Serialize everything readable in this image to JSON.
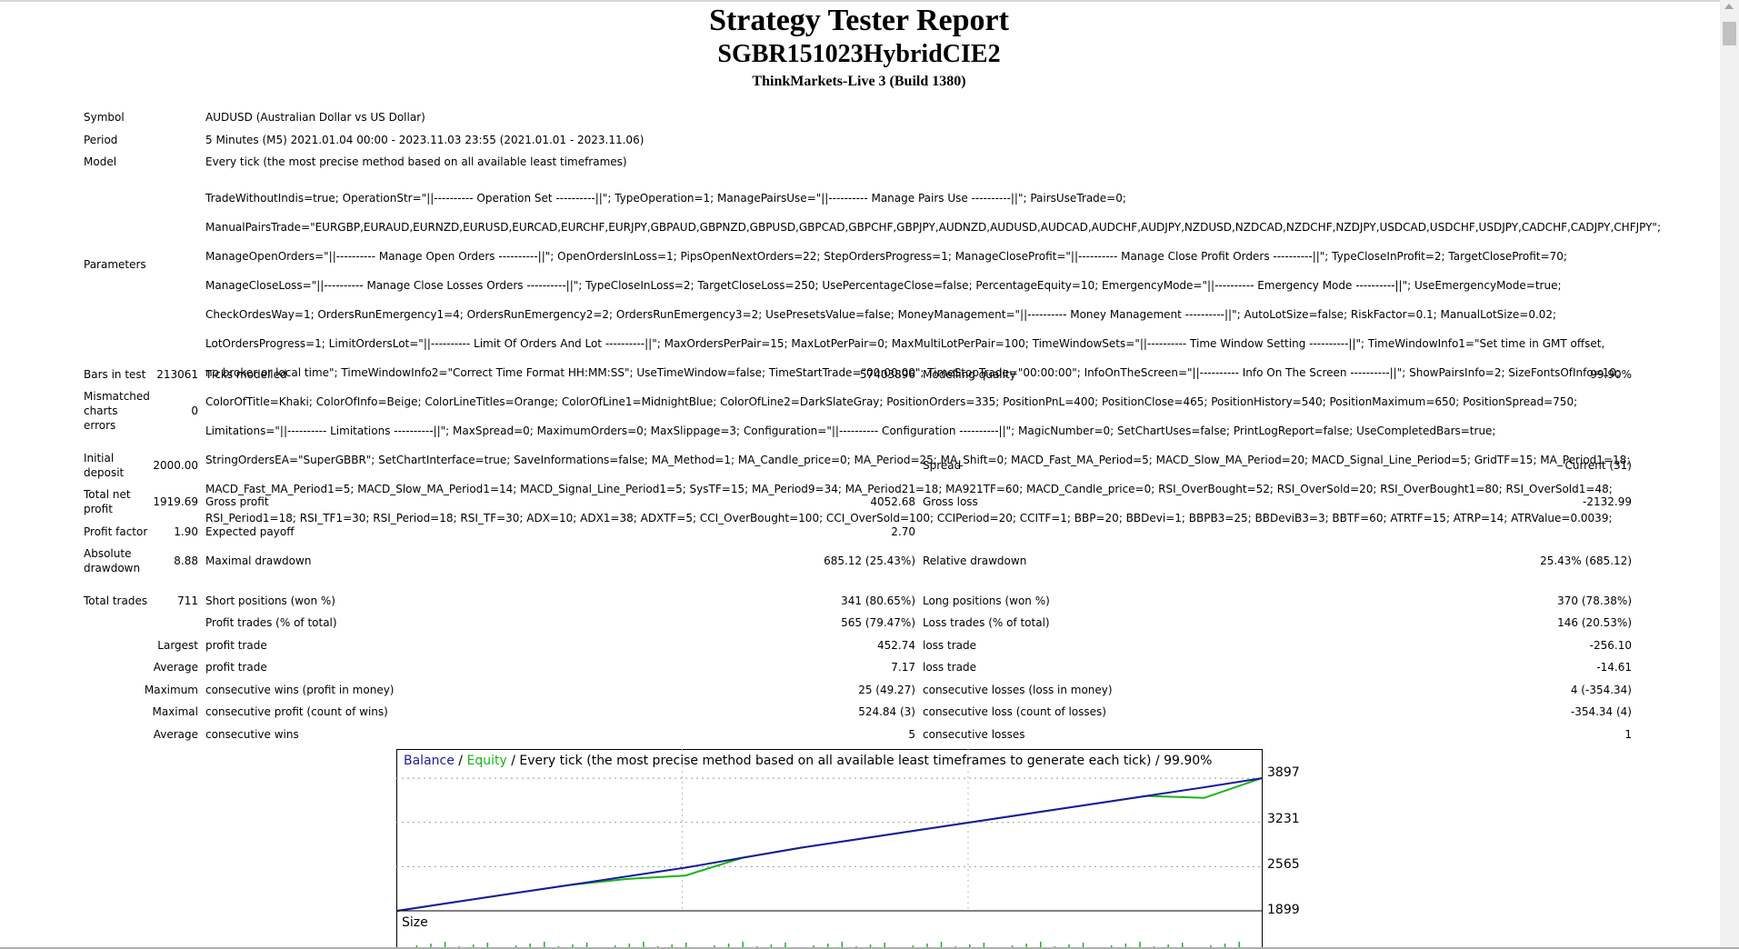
{
  "header": {
    "title": "Strategy Tester Report",
    "ea_name": "SGBR151023HybridCIE2",
    "server": "ThinkMarkets-Live 3 (Build 1380)"
  },
  "info": {
    "symbol_label": "Symbol",
    "symbol_value": "AUDUSD (Australian Dollar vs US Dollar)",
    "period_label": "Period",
    "period_value": "5 Minutes (M5) 2021.01.04 00:00 - 2023.11.03 23:55 (2021.01.01 - 2023.11.06)",
    "model_label": "Model",
    "model_value": "Every tick (the most precise method based on all available least timeframes)",
    "parameters_label": "Parameters",
    "parameters_lines": [
      "TradeWithoutIndis=true; OperationStr=\"||---------- Operation Set ----------||\"; TypeOperation=1; ManagePairsUse=\"||---------- Manage Pairs Use ----------||\"; PairsUseTrade=0;",
      "ManualPairsTrade=\"EURGBP,EURAUD,EURNZD,EURUSD,EURCAD,EURCHF,EURJPY,GBPAUD,GBPNZD,GBPUSD,GBPCAD,GBPCHF,GBPJPY,AUDNZD,AUDUSD,AUDCAD,AUDCHF,AUDJPY,NZDUSD,NZDCAD,NZDCHF,NZDJPY,USDCAD,USDCHF,USDJPY,CADCHF,CADJPY,CHFJPY\";",
      "ManageOpenOrders=\"||---------- Manage Open Orders ----------||\"; OpenOrdersInLoss=1; PipsOpenNextOrders=22; StepOrdersProgress=1; ManageCloseProfit=\"||---------- Manage Close Profit Orders ----------||\"; TypeCloseInProfit=2; TargetCloseProfit=70;",
      "ManageCloseLoss=\"||---------- Manage Close Losses Orders ----------||\"; TypeCloseInLoss=2; TargetCloseLoss=250; UsePercentageClose=false; PercentageEquity=10; EmergencyMode=\"||---------- Emergency Mode ----------||\"; UseEmergencyMode=true;",
      "CheckOrdesWay=1; OrdersRunEmergency1=4; OrdersRunEmergency2=2; OrdersRunEmergency3=2; UsePresetsValue=false; MoneyManagement=\"||---------- Money Management ----------||\"; AutoLotSize=false; RiskFactor=0.1; ManualLotSize=0.02;",
      "LotOrdersProgress=1; LimitOrdersLot=\"||---------- Limit Of Orders And Lot ----------||\"; MaxOrdersPerPair=15; MaxLotPerPair=0; MaxMultiLotPerPair=100; TimeWindowSets=\"||---------- Time Window Setting ----------||\"; TimeWindowInfo1=\"Set time in GMT offset,",
      "no broker or local time\"; TimeWindowInfo2=\"Correct Time Format HH:MM:SS\"; UseTimeWindow=false; TimeStartTrade=\"00:00:00\"; TimeStopTrade=\"00:00:00\"; InfoOnTheScreen=\"||---------- Info On The Screen ----------||\"; ShowPairsInfo=2; SizeFontsOfInfo=10;",
      "ColorOfTitle=Khaki; ColorOfInfo=Beige; ColorLineTitles=Orange; ColorOfLine1=MidnightBlue; ColorOfLine2=DarkSlateGray; PositionOrders=335; PositionPnL=400; PositionClose=465; PositionHistory=540; PositionMaximum=650; PositionSpread=750;",
      "Limitations=\"||---------- Limitations ----------||\"; MaxSpread=0; MaximumOrders=0; MaxSlippage=3; Configuration=\"||---------- Configuration ----------||\"; MagicNumber=0; SetChartUses=false; PrintLogReport=false; UseCompletedBars=true;",
      "StringOrdersEA=\"SuperGBBR\"; SetChartInterface=true; SaveInformations=false; MA_Method=1; MA_Candle_price=0; MA_Period=25; MA_Shift=0; MACD_Fast_MA_Period=5; MACD_Slow_MA_Period=20; MACD_Signal_Line_Period=5; GridTF=15; MA_Period1=18;",
      "MACD_Fast_MA_Period1=5; MACD_Slow_MA_Period1=14; MACD_Signal_Line_Period1=5; SysTF=15; MA_Period9=34; MA_Period21=18; MA921TF=60; MACD_Candle_price=0; RSI_OverBought=52; RSI_OverSold=20; RSI_OverBought1=80; RSI_OverSold1=48;",
      "RSI_Period1=18; RSI_TF1=30; RSI_Period=18; RSI_TF=30; ADX=10; ADX1=38; ADXTF=5; CCI_OverBought=100; CCI_OverSold=100; CCIPeriod=20; CCITF=1; BBP=20; BBDevi=1; BBPB3=25; BBDeviB3=3; BBTF=60; ATRTF=15; ATRP=14; ATRValue=0.0039;"
    ]
  },
  "stats": {
    "bars_label": "Bars in test",
    "bars_value": "213061",
    "ticks_label": "Ticks modelled",
    "ticks_value": "57403896",
    "quality_label": "Modelling quality",
    "quality_value": "99.90%",
    "mismatch_label_1": "Mismatched",
    "mismatch_label_2": "charts",
    "mismatch_label_3": "errors",
    "mismatch_value": "0",
    "deposit_label_1": "Initial",
    "deposit_label_2": "deposit",
    "deposit_value": "2000.00",
    "spread_label": "Spread",
    "spread_value": "Current (31)",
    "net_label_1": "Total net",
    "net_label_2": "profit",
    "net_value": "1919.69",
    "gross_profit_label": "Gross profit",
    "gross_profit_value": "4052.68",
    "gross_loss_label": "Gross loss",
    "gross_loss_value": "-2132.99",
    "pf_label": "Profit factor",
    "pf_value": "1.90",
    "ep_label": "Expected payoff",
    "ep_value": "2.70",
    "abs_dd_label_1": "Absolute",
    "abs_dd_label_2": "drawdown",
    "abs_dd_value": "8.88",
    "max_dd_label": "Maximal drawdown",
    "max_dd_value": "685.12 (25.43%)",
    "rel_dd_label": "Relative drawdown",
    "rel_dd_value": "25.43% (685.12)",
    "total_trades_label": "Total trades",
    "total_trades_value": "711",
    "short_label": "Short positions (won %)",
    "short_value": "341 (80.65%)",
    "long_label": "Long positions (won %)",
    "long_value": "370 (78.38%)",
    "profit_trades_label": "Profit trades (% of total)",
    "profit_trades_value": "565 (79.47%)",
    "loss_trades_label": "Loss trades (% of total)",
    "loss_trades_value": "146 (20.53%)",
    "largest_label": "Largest",
    "largest_profit_label": "profit trade",
    "largest_profit_value": "452.74",
    "largest_loss_label": "loss trade",
    "largest_loss_value": "-256.10",
    "average_label": "Average",
    "average_profit_label": "profit trade",
    "average_profit_value": "7.17",
    "average_loss_label": "loss trade",
    "average_loss_value": "-14.61",
    "maximum_label": "Maximum",
    "max_cons_wins_label": "consecutive wins (profit in money)",
    "max_cons_wins_value": "25 (49.27)",
    "max_cons_losses_label": "consecutive losses (loss in money)",
    "max_cons_losses_value": "4 (-354.34)",
    "maximal_label": "Maximal",
    "maximal_profit_label": "consecutive profit (count of wins)",
    "maximal_profit_value": "524.84 (3)",
    "maximal_loss_label": "consecutive loss (count of losses)",
    "maximal_loss_value": "-354.34 (4)",
    "avg_cons_label": "Average",
    "avg_cons_wins_label": "consecutive wins",
    "avg_cons_wins_value": "5",
    "avg_cons_losses_label": "consecutive losses",
    "avg_cons_losses_value": "1"
  },
  "chart_legend": {
    "balance": "Balance",
    "sep1": " / ",
    "equity": "Equity",
    "rest": " / Every tick (the most precise method based on all available least timeframes to generate each tick) / 99.90%"
  },
  "size_label": "Size",
  "colors": {
    "balance": "#1a1aa0",
    "equity": "#18b418",
    "frame": "#000000"
  },
  "chart_data": {
    "type": "line",
    "title": "",
    "ytick_labels": [
      "3897",
      "3231",
      "2565",
      "1899"
    ],
    "ylim": [
      1899,
      4063
    ],
    "series": [
      {
        "name": "Balance",
        "values": [
          1899,
          2030,
          2160,
          2290,
          2420,
          2550,
          2700,
          2850,
          2980,
          3110,
          3240,
          3370,
          3500,
          3630,
          3760,
          3897
        ]
      },
      {
        "name": "Equity",
        "values": [
          1899,
          2030,
          2160,
          2290,
          2380,
          2430,
          2700,
          2850,
          2980,
          3110,
          3240,
          3370,
          3500,
          3630,
          3600,
          3897
        ]
      }
    ]
  }
}
